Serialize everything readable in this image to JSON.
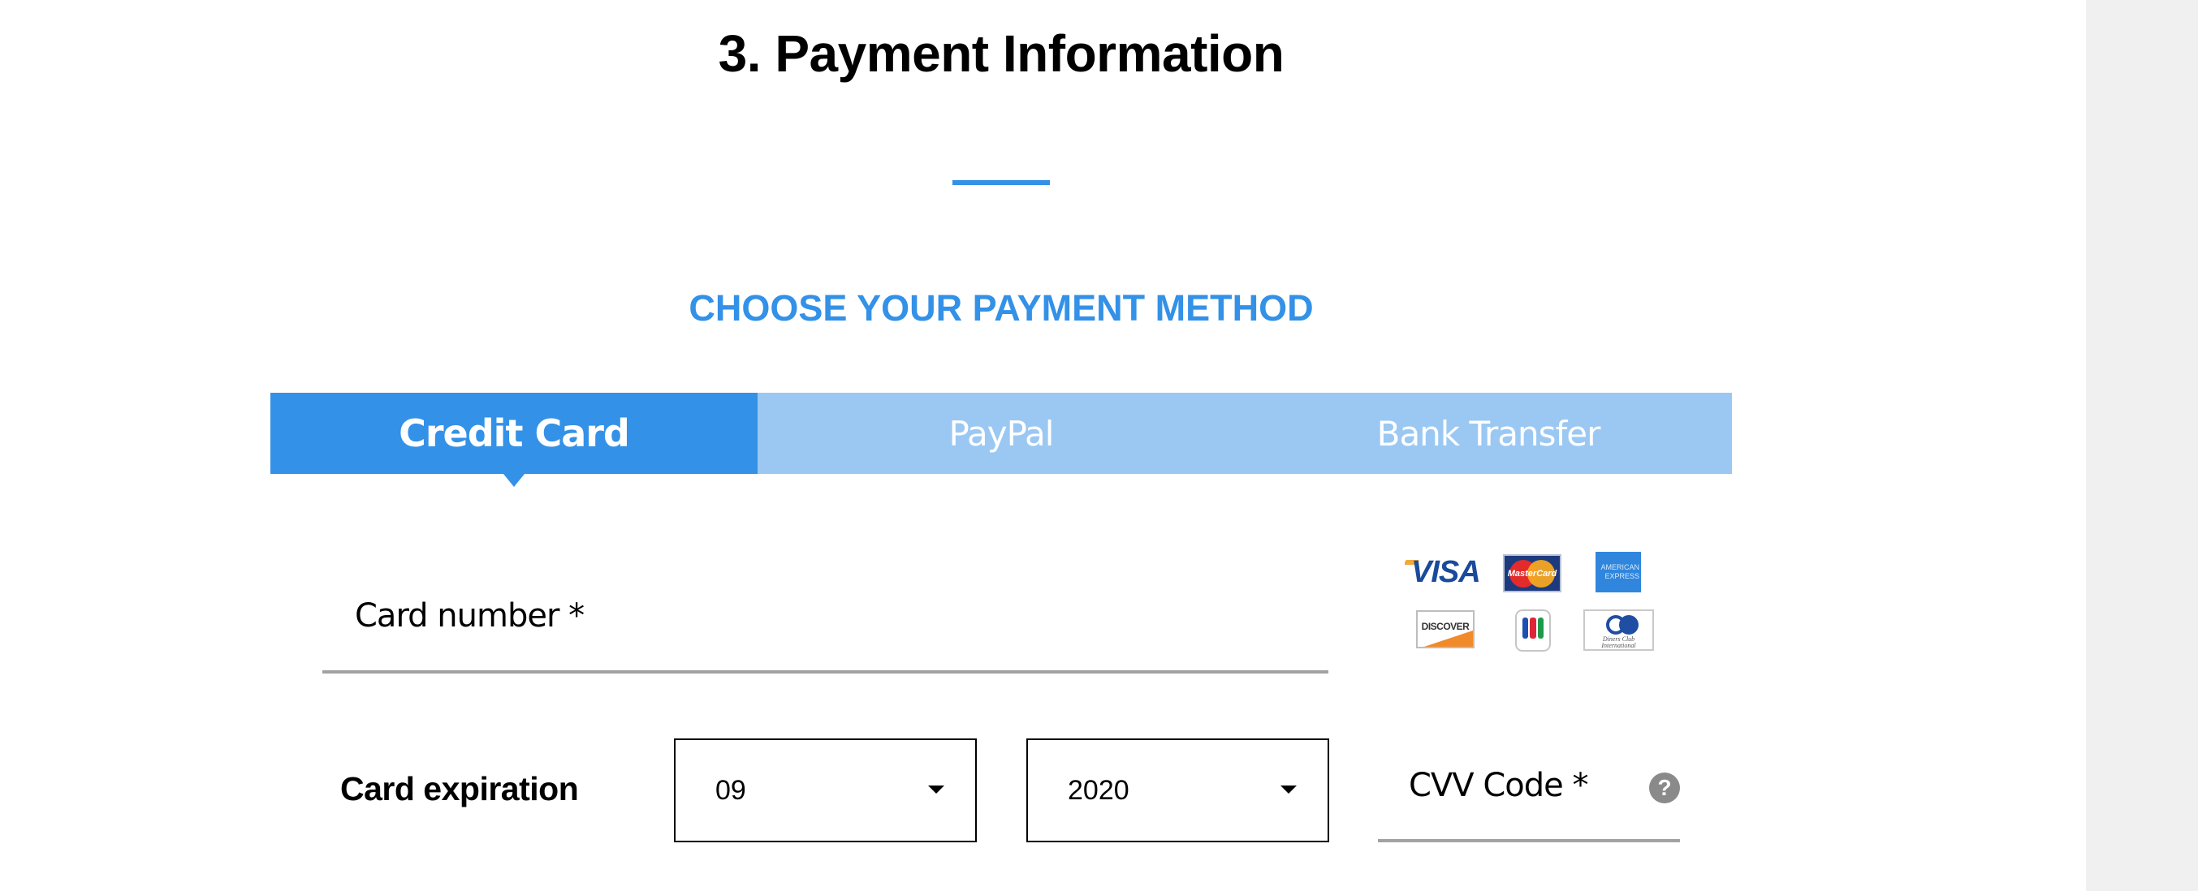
{
  "header": {
    "title": "3. Payment Information",
    "accent_color": "#3391e7"
  },
  "payment_method": {
    "heading": "CHOOSE YOUR PAYMENT METHOD",
    "tabs": [
      {
        "label": "Credit Card",
        "active": true
      },
      {
        "label": "PayPal",
        "active": false
      },
      {
        "label": "Bank Transfer",
        "active": false
      }
    ],
    "active_tab_color": "#3391e7",
    "inactive_tab_color": "#9bc8f3"
  },
  "card_form": {
    "card_number": {
      "label": "Card number *",
      "value": ""
    },
    "accepted_cards": [
      {
        "name": "visa-logo",
        "text": "VISA"
      },
      {
        "name": "mastercard-logo",
        "text": "MasterCard"
      },
      {
        "name": "amex-logo",
        "text": "AMERICAN EXPRESS"
      },
      {
        "name": "discover-logo",
        "text": "DISCOVER"
      },
      {
        "name": "jcb-logo",
        "text": "JCB"
      },
      {
        "name": "diners-club-logo",
        "text": "Diners Club International"
      }
    ],
    "expiration": {
      "label": "Card expiration",
      "month": {
        "selected": "09"
      },
      "year": {
        "selected": "2020"
      }
    },
    "cvv": {
      "label": "CVV Code *",
      "help_icon": "?"
    }
  }
}
